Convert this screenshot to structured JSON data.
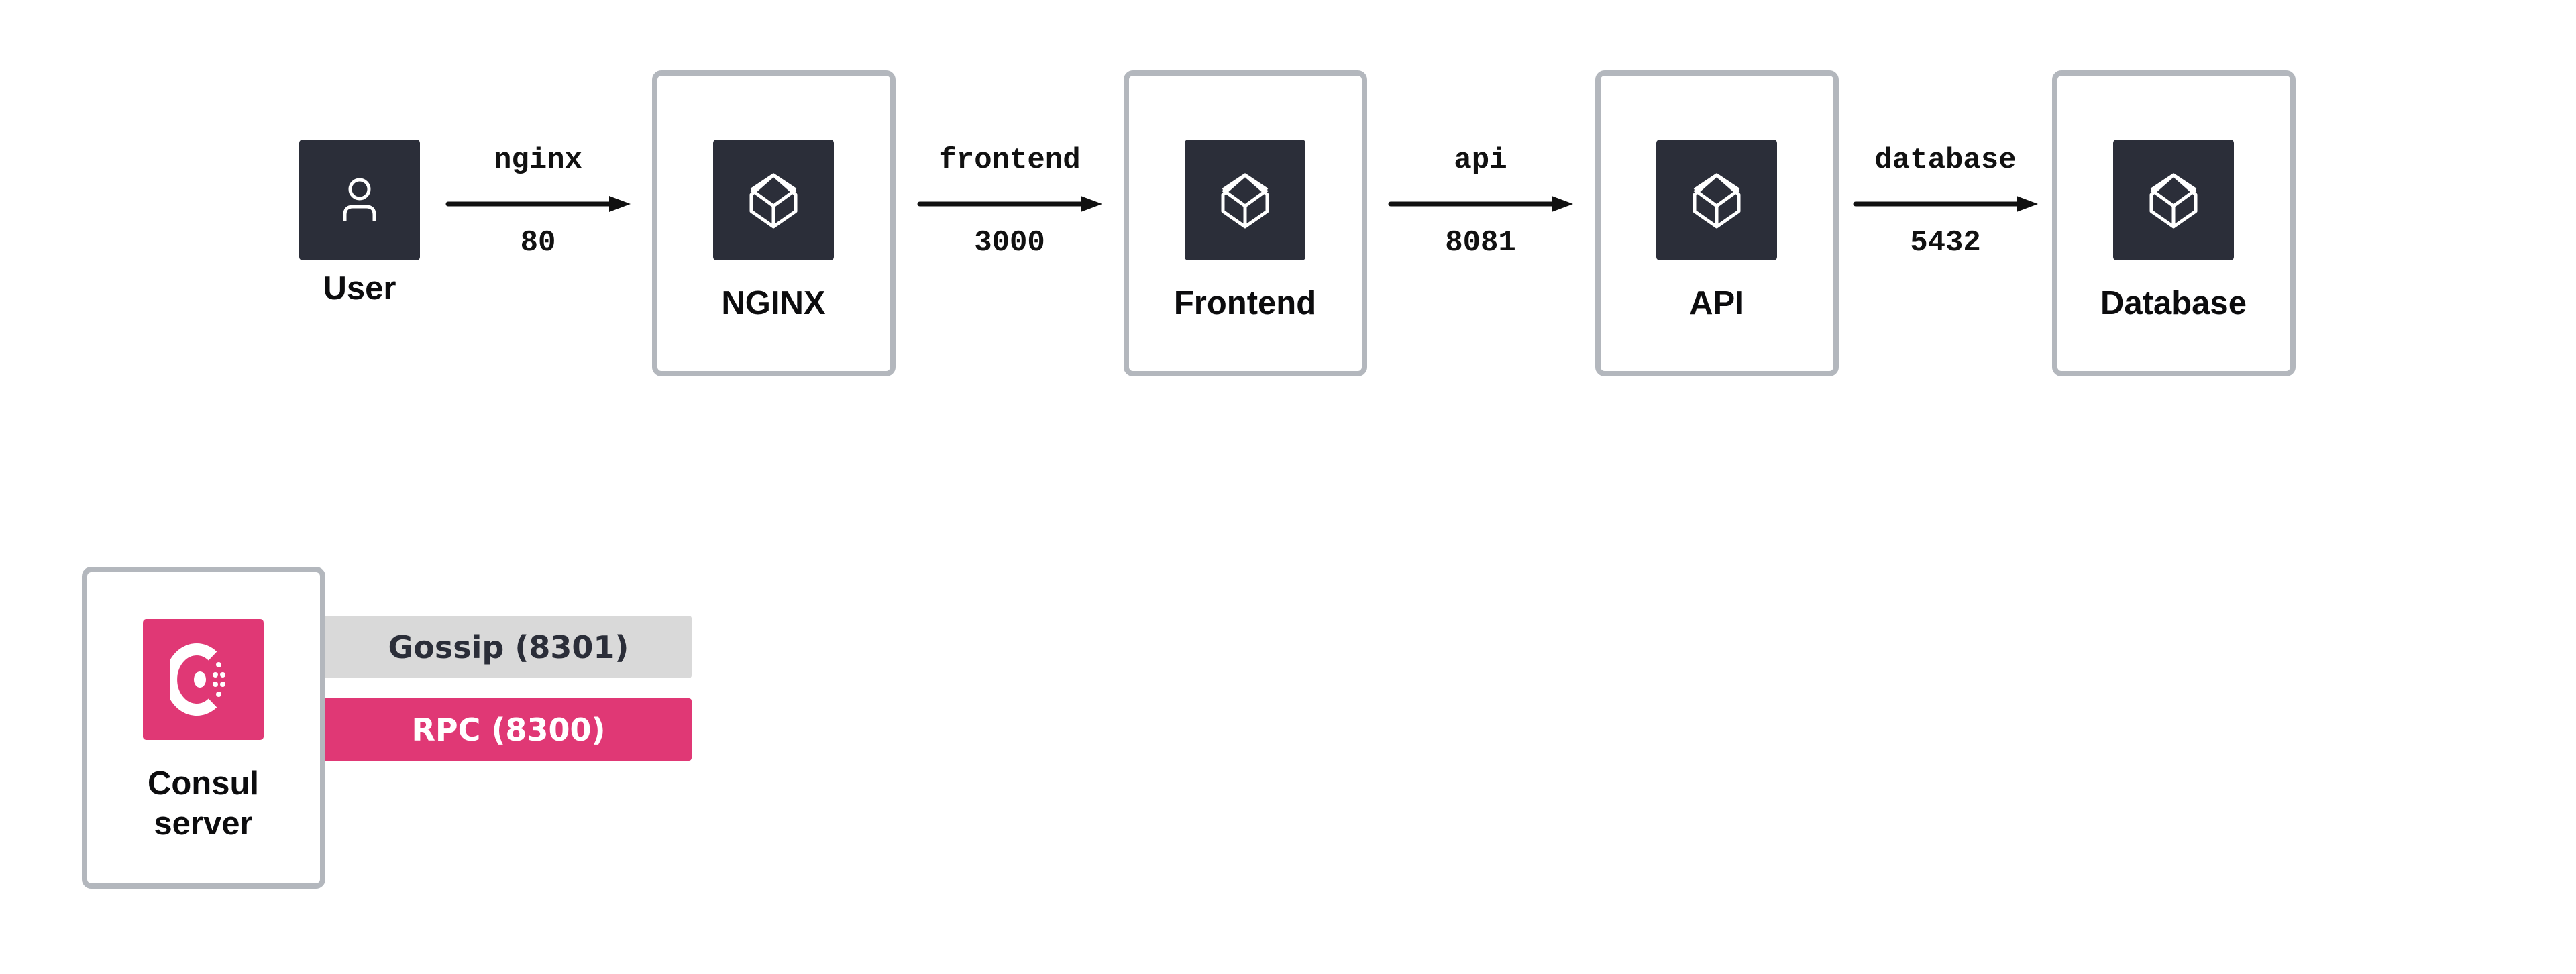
{
  "nodes": [
    {
      "id": "user",
      "label": "User",
      "icon": "user-icon"
    },
    {
      "id": "nginx",
      "label": "NGINX",
      "icon": "cube-icon"
    },
    {
      "id": "frontend",
      "label": "Frontend",
      "icon": "cube-icon"
    },
    {
      "id": "api",
      "label": "API",
      "icon": "cube-icon"
    },
    {
      "id": "database",
      "label": "Database",
      "icon": "cube-icon"
    }
  ],
  "edges": [
    {
      "name": "nginx",
      "port": "80"
    },
    {
      "name": "frontend",
      "port": "3000"
    },
    {
      "name": "api",
      "port": "8081"
    },
    {
      "name": "database",
      "port": "5432"
    }
  ],
  "consul": {
    "label_line1": "Consul",
    "label_line2": "server",
    "icon": "consul-logo-icon",
    "gossip": "Gossip (8301)",
    "rpc": "RPC (8300)"
  },
  "colors": {
    "icon_bg": "#2b2e39",
    "box_border": "#b3b7bd",
    "consul_pink": "#e03875",
    "gossip_gray": "#d9d9d9"
  }
}
